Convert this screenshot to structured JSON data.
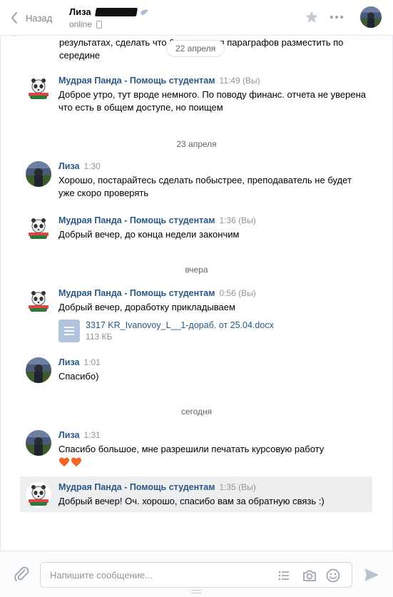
{
  "header": {
    "back_label": "Назад",
    "peer_name": "Лиза",
    "peer_status": "online"
  },
  "history": {
    "cut_text": "результатах, сделать что                 6 и названия параграфов разместить по середине",
    "floating_date": "22 апреля",
    "messages": [
      {
        "author": "Мудрая Панда - Помощь студентам",
        "time": "11:49 (Вы)",
        "text": "Доброе утро, тут вроде немного. По поводу финанс. отчета не уверена что есть в общем доступе, но поищем",
        "avatar": "panda"
      },
      {
        "date": "23 апреля"
      },
      {
        "author": "Лиза",
        "time": "1:30",
        "text": "Хорошо, постарайтесь сделать побыстрее, преподаватель не будет уже скоро проверять",
        "avatar": "photo"
      },
      {
        "author": "Мудрая Панда - Помощь студентам",
        "time": "1:36 (Вы)",
        "text": "Добрый вечер, до конца недели закончим",
        "avatar": "panda"
      },
      {
        "date": "вчера"
      },
      {
        "author": "Мудрая Панда - Помощь студентам",
        "time": "0:56 (Вы)",
        "text": "Добрый вечер, доработку прикладываем",
        "avatar": "panda",
        "doc": {
          "name": "3317 KR_Ivanovoy_L__1-дораб. от 25.04.docx",
          "size": "113 КБ"
        }
      },
      {
        "author": "Лиза",
        "time": "1:01",
        "text": "Спасибо)",
        "avatar": "photo"
      },
      {
        "date": "сегодня"
      },
      {
        "author": "Лиза",
        "time": "1:31",
        "text": "Спасибо большое, мне разрешили печатать курсовую работу",
        "avatar": "photo",
        "emoji": "❤❤"
      },
      {
        "author": "Мудрая Панда - Помощь студентам",
        "time": "1:35 (Вы)",
        "text": "Добрый вечер! Оч. хорошо, спасибо вам за обратную связь :)",
        "avatar": "panda",
        "highlighted": true
      }
    ]
  },
  "composer": {
    "placeholder": "Напишите сообщение..."
  },
  "colors": {
    "link": "#2a5885",
    "muted": "#939393",
    "highlight_bg": "#edeef0",
    "heart": "#f2642a"
  },
  "icons": [
    "chevron-left-icon",
    "star-icon",
    "more-icon",
    "phone-icon",
    "verified-icon",
    "paperclip-icon",
    "list-icon",
    "camera-icon",
    "smile-icon",
    "send-icon",
    "document-icon",
    "heart-icon"
  ]
}
